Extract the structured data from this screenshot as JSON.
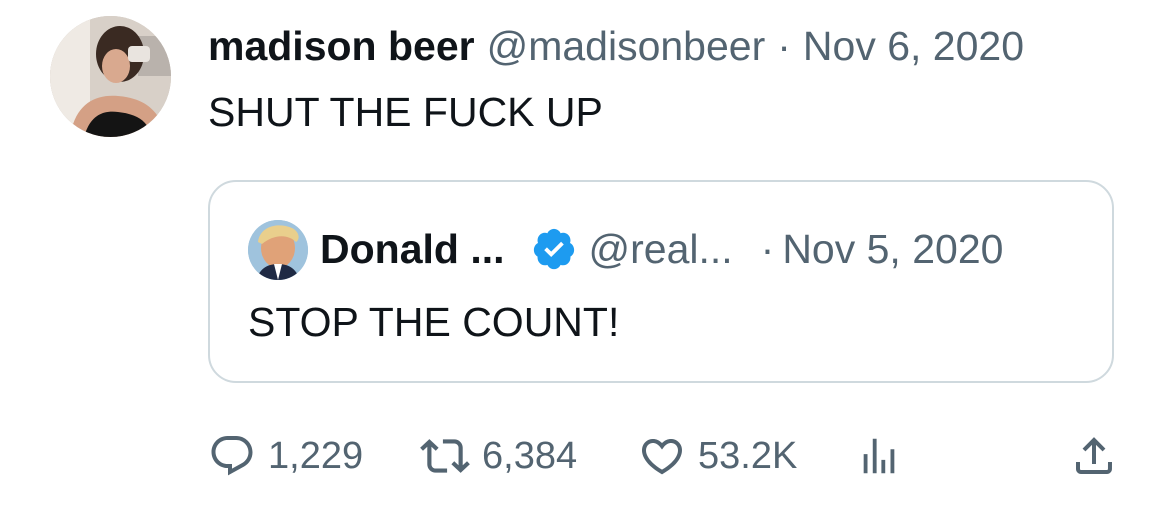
{
  "tweet": {
    "author": {
      "display_name": "madison beer",
      "handle": "@madisonbeer"
    },
    "separator": "·",
    "date": "Nov 6, 2020",
    "text": "SHUT THE FUCK UP"
  },
  "quoted_tweet": {
    "author": {
      "display_name": "Donald ...",
      "handle": "@real...",
      "verified": true,
      "verified_icon": "verified-badge-icon"
    },
    "separator": "·",
    "date": "Nov 5, 2020",
    "text": "STOP THE COUNT!"
  },
  "actions": {
    "reply": {
      "icon": "reply-icon",
      "count": "1,229"
    },
    "retweet": {
      "icon": "retweet-icon",
      "count": "6,384"
    },
    "like": {
      "icon": "heart-icon",
      "count": "53.2K"
    },
    "views": {
      "icon": "analytics-icon"
    },
    "share": {
      "icon": "share-icon"
    }
  },
  "colors": {
    "text_primary": "#0f1419",
    "text_secondary": "#536471",
    "border": "#cfd9de",
    "verified_blue": "#1d9bf0"
  }
}
